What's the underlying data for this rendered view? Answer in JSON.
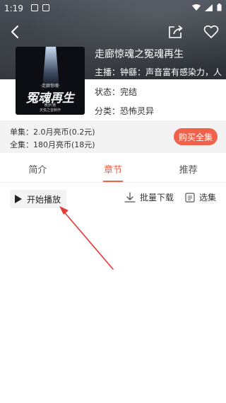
{
  "status_bar": {
    "time": "1:19"
  },
  "book": {
    "title": "走廊惊魂之冤魂再生",
    "host": "主播：钟繇：声音富有感染力，人",
    "status": "状态：完结",
    "category": "分类：恐怖灵异",
    "cover": {
      "subtitle": "·走廊惊魂·",
      "title": "冤魂再生",
      "author": "晚步/著",
      "studio": "天悦之音制作"
    }
  },
  "price": {
    "single": "单集：2.0月亮币(0.2元)",
    "all": "全集：180月亮币(18元)",
    "buy_label": "购买全集"
  },
  "tabs": [
    {
      "label": "简介"
    },
    {
      "label": "章节"
    },
    {
      "label": "推荐"
    }
  ],
  "actions": {
    "play_label": "开始播放",
    "download_label": "批量下载",
    "select_label": "选集"
  },
  "colors": {
    "accent": "#f0624a",
    "annotation": "#e53935"
  },
  "icons": [
    "back-arrow-icon",
    "share-icon",
    "heart-icon",
    "play-icon",
    "download-icon",
    "list-icon"
  ]
}
